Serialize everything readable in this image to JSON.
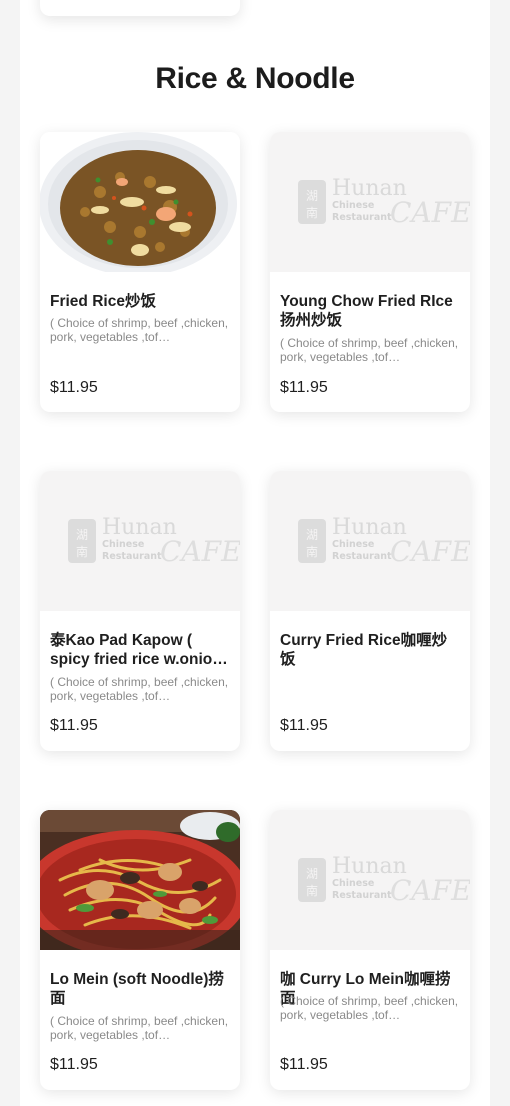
{
  "section": {
    "title": "Rice & Noodle"
  },
  "placeholder_logo": {
    "seal": "湖南",
    "name": "Hunan",
    "sub1": "Chinese",
    "sub2": "Restaurant",
    "script": "CAFE"
  },
  "items": [
    {
      "name": "Fried Rice炒饭",
      "desc": "( Choice of shrimp, beef ,chicken, pork, vegetables ,tof…",
      "price": "$11.95"
    },
    {
      "name": "Young Chow Fried RIce 扬州炒饭",
      "desc": "( Choice of shrimp, beef ,chicken, pork, vegetables ,tof…",
      "price": "$11.95"
    },
    {
      "name": "泰Kao Pad Kapow ( spicy fried rice w.onio…",
      "desc": "( Choice of shrimp, beef ,chicken, pork, vegetables ,tof…",
      "price": "$11.95"
    },
    {
      "name": "Curry Fried Rice咖喱炒饭",
      "desc": "",
      "price": "$11.95"
    },
    {
      "name": "Lo Mein (soft Noodle)捞面",
      "desc": "( Choice of shrimp, beef ,chicken, pork, vegetables ,tof…",
      "price": "$11.95"
    },
    {
      "name": "咖 Curry Lo Mein咖喱捞面",
      "desc": "( Choice of shrimp, beef ,chicken, pork, vegetables ,tof…",
      "price": "$11.95"
    }
  ]
}
